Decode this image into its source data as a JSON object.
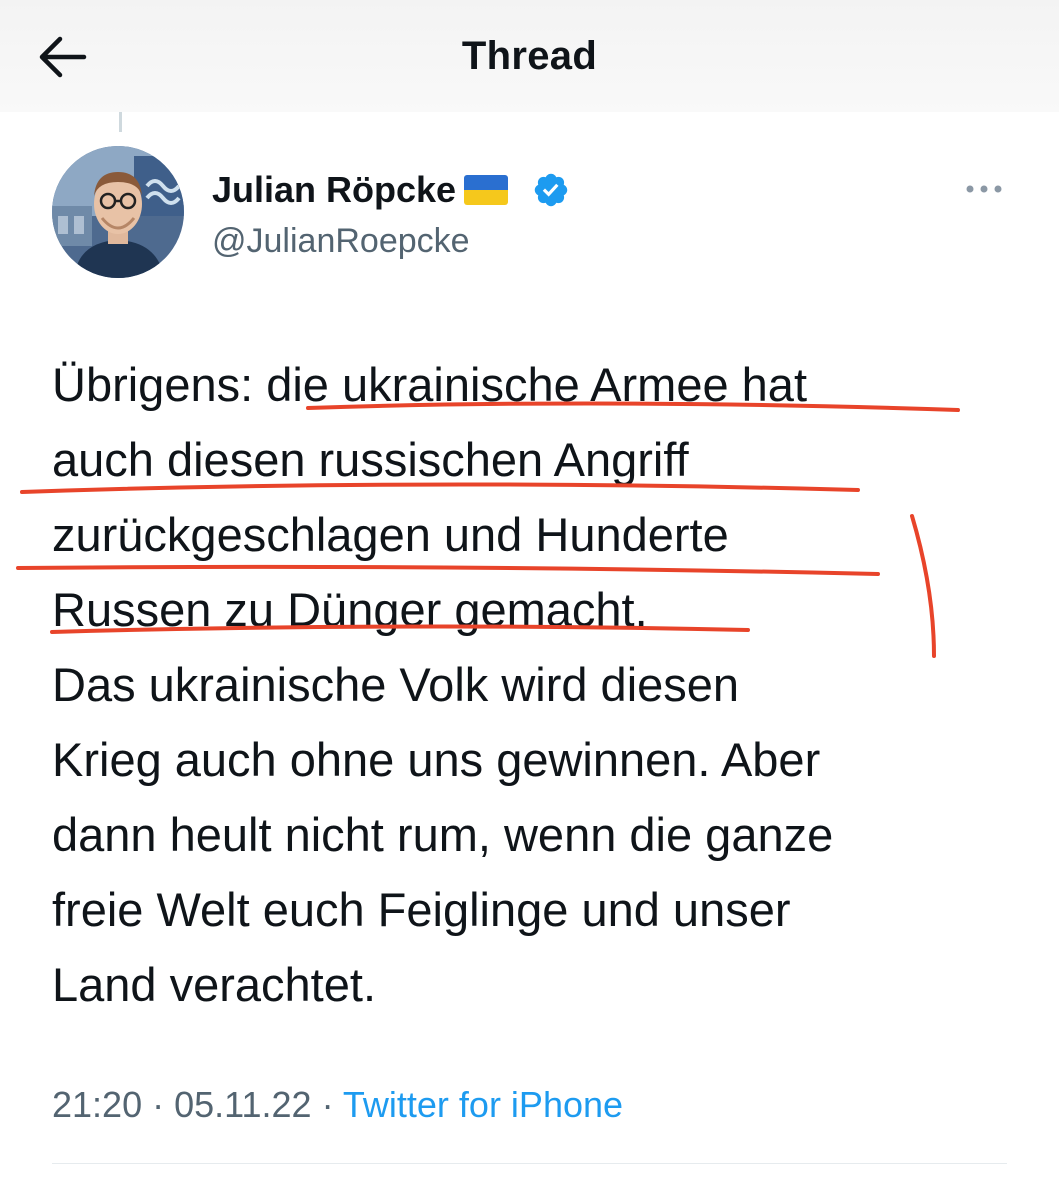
{
  "header": {
    "title": "Thread",
    "back_icon": "arrow-left-icon"
  },
  "author": {
    "name": "Julian Röpcke",
    "flag_icon": "ukraine-flag-icon",
    "verified_icon": "verified-badge-icon",
    "handle": "@JulianRoepcke"
  },
  "more_icon": "more-horizontal-icon",
  "tweet": {
    "text": "Übrigens: die ukrainische Armee hat\nauch diesen russischen Angriff\nzurückgeschlagen und Hunderte\nRussen zu Dünger gemacht.\nDas ukrainische Volk wird diesen\nKrieg auch ohne uns gewinnen. Aber\ndann heult nicht rum, wenn die ganze\nfreie Welt euch Feiglinge und unser\nLand verachtet."
  },
  "meta": {
    "time": "21:20",
    "separator": " · ",
    "date": "05.11.22",
    "source": "Twitter for iPhone"
  },
  "colors": {
    "text": "#0f1419",
    "secondary": "#536471",
    "accent": "#1d9bf0",
    "annotation": "#e8442a"
  }
}
